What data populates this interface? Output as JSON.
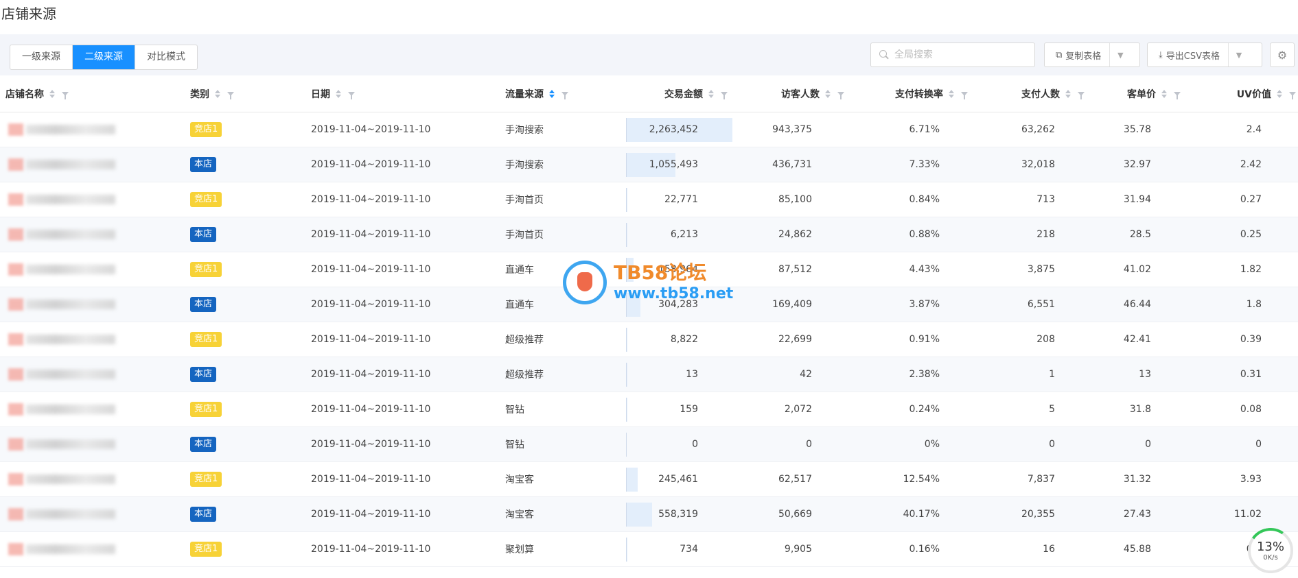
{
  "page_title": "店铺来源",
  "tabs": [
    {
      "label": "一级来源",
      "active": false
    },
    {
      "label": "二级来源",
      "active": true
    },
    {
      "label": "对比模式",
      "active": false
    }
  ],
  "search": {
    "placeholder": "全局搜索"
  },
  "toolbar": {
    "copy_label": "复制表格",
    "export_label": "导出CSV表格"
  },
  "columns": [
    "店铺名称",
    "类别",
    "日期",
    "流量来源",
    "交易金额",
    "访客人数",
    "支付转换率",
    "支付人数",
    "客单价",
    "UV价值"
  ],
  "tag_colors": {
    "竞店1": "#f7d237",
    "本店": "#1565c0"
  },
  "rows": [
    {
      "type": "竞店1",
      "date": "2019-11-04~2019-11-10",
      "source": "手淘搜索",
      "amount": "2,263,452",
      "amount_value": 2263452,
      "visitors": "943,375",
      "conv": "6.71%",
      "buyers": "63,262",
      "aov": "35.78",
      "uv": "2.4"
    },
    {
      "type": "本店",
      "date": "2019-11-04~2019-11-10",
      "source": "手淘搜索",
      "amount": "1,055,493",
      "amount_value": 1055493,
      "visitors": "436,731",
      "conv": "7.33%",
      "buyers": "32,018",
      "aov": "32.97",
      "uv": "2.42"
    },
    {
      "type": "竞店1",
      "date": "2019-11-04~2019-11-10",
      "source": "手淘首页",
      "amount": "22,771",
      "amount_value": 22771,
      "visitors": "85,100",
      "conv": "0.84%",
      "buyers": "713",
      "aov": "31.94",
      "uv": "0.27"
    },
    {
      "type": "本店",
      "date": "2019-11-04~2019-11-10",
      "source": "手淘首页",
      "amount": "6,213",
      "amount_value": 6213,
      "visitors": "24,862",
      "conv": "0.88%",
      "buyers": "218",
      "aov": "28.5",
      "uv": "0.25"
    },
    {
      "type": "竞店1",
      "date": "2019-11-04~2019-11-10",
      "source": "直通车",
      "amount": "158,964",
      "amount_value": 158964,
      "visitors": "87,512",
      "conv": "4.43%",
      "buyers": "3,875",
      "aov": "41.02",
      "uv": "1.82"
    },
    {
      "type": "本店",
      "date": "2019-11-04~2019-11-10",
      "source": "直通车",
      "amount": "304,283",
      "amount_value": 304283,
      "visitors": "169,409",
      "conv": "3.87%",
      "buyers": "6,551",
      "aov": "46.44",
      "uv": "1.8"
    },
    {
      "type": "竞店1",
      "date": "2019-11-04~2019-11-10",
      "source": "超级推荐",
      "amount": "8,822",
      "amount_value": 8822,
      "visitors": "22,699",
      "conv": "0.91%",
      "buyers": "208",
      "aov": "42.41",
      "uv": "0.39"
    },
    {
      "type": "本店",
      "date": "2019-11-04~2019-11-10",
      "source": "超级推荐",
      "amount": "13",
      "amount_value": 13,
      "visitors": "42",
      "conv": "2.38%",
      "buyers": "1",
      "aov": "13",
      "uv": "0.31"
    },
    {
      "type": "竞店1",
      "date": "2019-11-04~2019-11-10",
      "source": "智钻",
      "amount": "159",
      "amount_value": 159,
      "visitors": "2,072",
      "conv": "0.24%",
      "buyers": "5",
      "aov": "31.8",
      "uv": "0.08"
    },
    {
      "type": "本店",
      "date": "2019-11-04~2019-11-10",
      "source": "智钻",
      "amount": "0",
      "amount_value": 0,
      "visitors": "0",
      "conv": "0%",
      "buyers": "0",
      "aov": "0",
      "uv": "0"
    },
    {
      "type": "竞店1",
      "date": "2019-11-04~2019-11-10",
      "source": "淘宝客",
      "amount": "245,461",
      "amount_value": 245461,
      "visitors": "62,517",
      "conv": "12.54%",
      "buyers": "7,837",
      "aov": "31.32",
      "uv": "3.93"
    },
    {
      "type": "本店",
      "date": "2019-11-04~2019-11-10",
      "source": "淘宝客",
      "amount": "558,319",
      "amount_value": 558319,
      "visitors": "50,669",
      "conv": "40.17%",
      "buyers": "20,355",
      "aov": "27.43",
      "uv": "11.02"
    },
    {
      "type": "竞店1",
      "date": "2019-11-04~2019-11-10",
      "source": "聚划算",
      "amount": "734",
      "amount_value": 734,
      "visitors": "9,905",
      "conv": "0.16%",
      "buyers": "16",
      "aov": "45.88",
      "uv": "0.1"
    }
  ],
  "watermark": {
    "title": "TB58论坛",
    "url": "www.tb58.net"
  },
  "progress": {
    "percent": "13%",
    "speed": "0K/s"
  }
}
